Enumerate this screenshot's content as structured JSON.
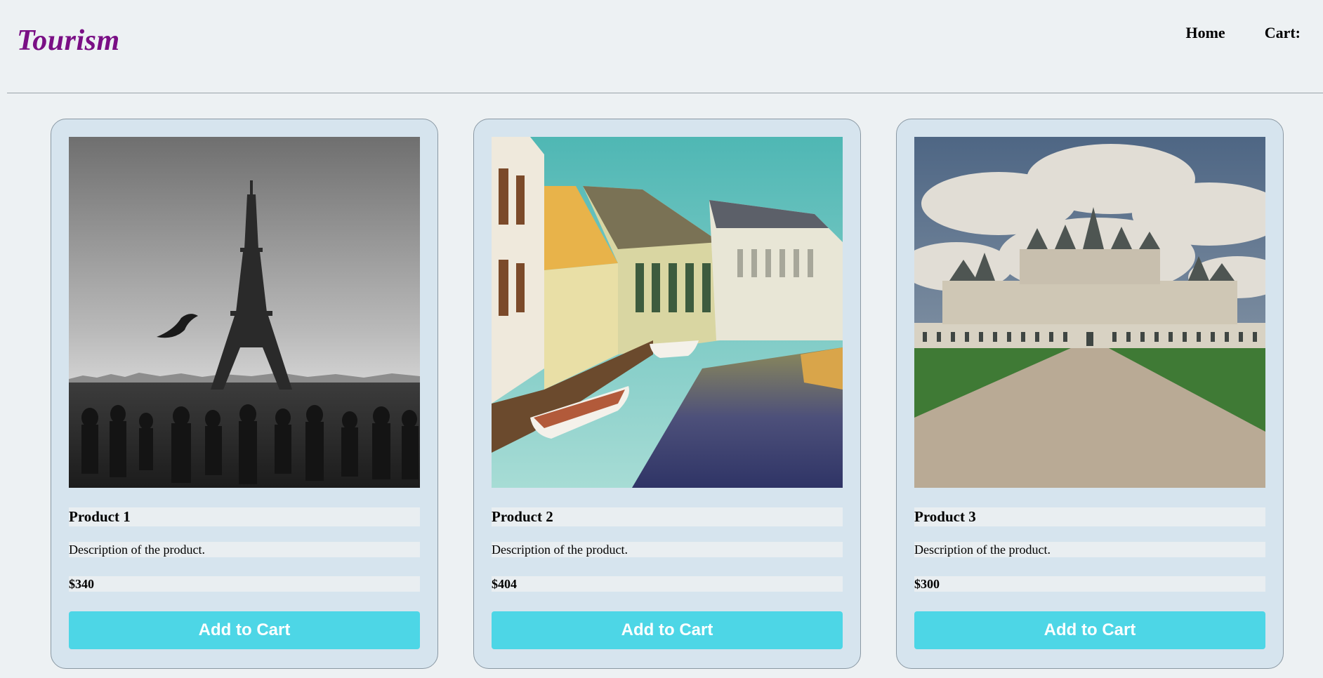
{
  "header": {
    "logo": "Tourism",
    "nav": [
      {
        "label": "Home"
      },
      {
        "label": "Cart:"
      }
    ]
  },
  "products": [
    {
      "name": "Product 1",
      "description": "Description of the product.",
      "price": "$340",
      "button_label": "Add to Cart"
    },
    {
      "name": "Product 2",
      "description": "Description of the product.",
      "price": "$404",
      "button_label": "Add to Cart"
    },
    {
      "name": "Product 3",
      "description": "Description of the product.",
      "price": "$300",
      "button_label": "Add to Cart"
    }
  ],
  "colors": {
    "page_background": "#edf1f3",
    "logo": "#7a0f85",
    "card_background": "#d6e4ee",
    "button": "#4dd6e6",
    "button_text": "#ffffff"
  }
}
